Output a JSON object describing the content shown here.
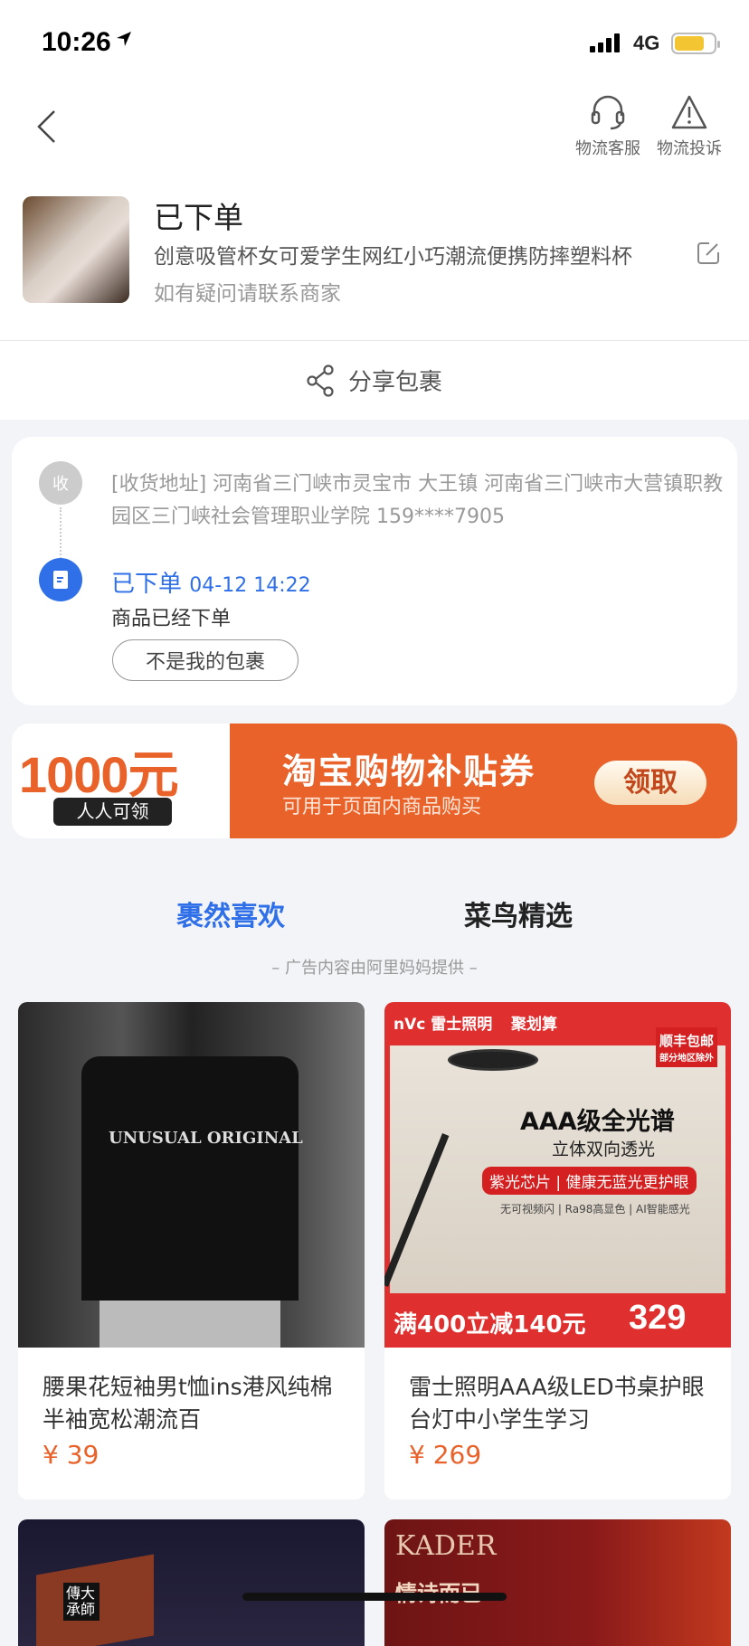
{
  "status_bar": {
    "time": "10:26",
    "network": "4G",
    "battery_level": 0.75
  },
  "header": {
    "back_label": "back",
    "actions": [
      {
        "label": "物流客服",
        "icon": "headset-icon"
      },
      {
        "label": "物流投诉",
        "icon": "warning-icon"
      }
    ]
  },
  "order": {
    "status": "已下单",
    "product_name": "创意吸管杯女可爱学生网红小巧潮流便携防摔塑料杯",
    "hint": "如有疑问请联系商家"
  },
  "share": {
    "label": "分享包裹"
  },
  "tracking": {
    "address_badge": "收",
    "address": "[收货地址] 河南省三门峡市灵宝市  大王镇   河南省三门峡市大营镇职教园区三门峡社会管理职业学院 159****7905",
    "event_status": "已下单",
    "event_time": "04-12 14:22",
    "event_desc": "商品已经下单",
    "not_mine_button": "不是我的包裹"
  },
  "coupon": {
    "amount": "1000元",
    "badge": "人人可领",
    "title": "淘宝购物补贴券",
    "subtitle": "可用于页面内商品购买",
    "claim_button": "领取",
    "accent": "#e8622a"
  },
  "tabs": [
    {
      "label": "裹然喜欢",
      "active": true
    },
    {
      "label": "菜鸟精选",
      "active": false
    }
  ],
  "ad_note": "– 广告内容由阿里妈妈提供 –",
  "products": [
    {
      "title": "腰果花短袖男t恤ins港风纯棉半袖宽松潮流百",
      "price": "¥ 39",
      "image_text": "UNUSUAL ORIGINAL"
    },
    {
      "title": "雷士照明AAA级LED书桌护眼台灯中小学生学习",
      "price": "¥ 269",
      "image_text": {
        "brand": "nVc 雷士照明",
        "campaign": "聚划算",
        "ship": "顺丰包邮",
        "ship_sub": "部分地区除外",
        "headline": "AAA级全光谱",
        "sub": "立体双向透光",
        "tag1": "紫光芯片",
        "tag2": "健康无蓝光更护眼",
        "features": "无可视频闪 | Ra98高显色 | AI智能感光",
        "promo": "满400立减140元",
        "promo_price": "329"
      }
    }
  ],
  "more_products": [
    {
      "image_text": "傳大 承師"
    },
    {
      "image_text": "KADER",
      "image_sub": "情诗而已"
    }
  ]
}
